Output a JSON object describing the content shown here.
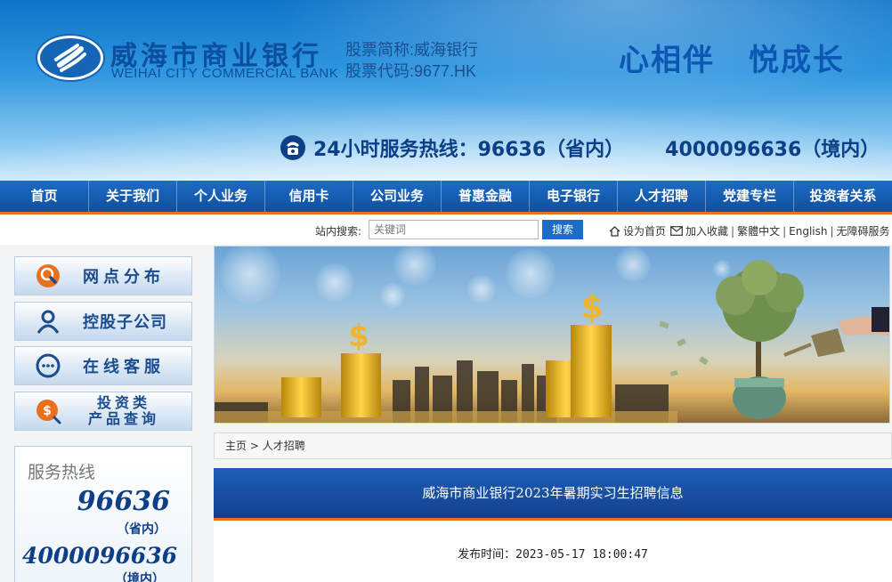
{
  "header": {
    "bank_name_cn": "威海市商业银行",
    "bank_name_en": "WEIHAI CITY COMMERCIAL BANK",
    "stock_abbr": "股票简称:威海银行",
    "stock_code": "股票代码:9677.HK",
    "slogan_1": "心相伴",
    "slogan_2": "悦成长",
    "hotline_label": "24小时服务热线：",
    "hotline_1": "96636（省内）",
    "hotline_2": "4000096636（境内）",
    "colors": {
      "brand_blue": "#0c4f9e",
      "accent_orange": "#e9711e"
    }
  },
  "nav": {
    "items": [
      {
        "label": "首页"
      },
      {
        "label": "关于我们"
      },
      {
        "label": "个人业务"
      },
      {
        "label": "信用卡"
      },
      {
        "label": "公司业务"
      },
      {
        "label": "普惠金融"
      },
      {
        "label": "电子银行"
      },
      {
        "label": "人才招聘"
      },
      {
        "label": "党建专栏"
      },
      {
        "label": "投资者关系"
      }
    ]
  },
  "utility": {
    "search_label": "站内搜索:",
    "search_placeholder": "关键词",
    "search_button": "搜索",
    "set_home": "设为首页",
    "add_fav": "加入收藏",
    "traditional": "繁體中文",
    "english": "English",
    "accessibility": "无障碍服务"
  },
  "sidebar": {
    "items": [
      {
        "label": "网点分布",
        "icon": "location-pin-icon"
      },
      {
        "label": "控股子公司",
        "icon": "person-icon"
      },
      {
        "label": "在线客服",
        "icon": "chat-icon"
      },
      {
        "label_line1": "投资类",
        "label_line2": "产品查询",
        "icon": "dollar-search-icon"
      }
    ],
    "hotline": {
      "title": "服务热线",
      "num1": "96636",
      "num1_sub": "（省内）",
      "num2": "4000096636",
      "num2_sub": "（境内）"
    }
  },
  "breadcrumb": {
    "home": "主页",
    "sep": ">",
    "current": "人才招聘"
  },
  "article": {
    "title": "威海市商业银行2023年暑期实习生招聘信息",
    "publish_label": "发布时间：",
    "publish_time": "2023-05-17 18:00:47"
  }
}
